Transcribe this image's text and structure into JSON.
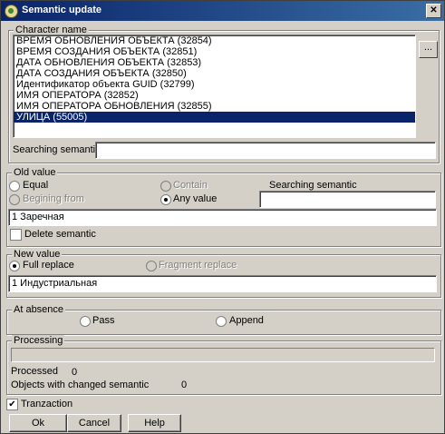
{
  "window": {
    "title": "Semantic update",
    "close_glyph": "✕"
  },
  "character_name": {
    "legend": "Character name",
    "items": [
      "ВРЕМЯ ОБНОВЛЕНИЯ ОБЪЕКТА (32854)",
      "ВРЕМЯ СОЗДАНИЯ ОБЪЕКТА (32851)",
      "ДАТА ОБНОВЛЕНИЯ ОБЪЕКТА (32853)",
      "ДАТА СОЗДАНИЯ ОБЪЕКТА (32850)",
      "Идентификатор объекта GUID (32799)",
      "ИМЯ ОПЕРАТОРА (32852)",
      "ИМЯ ОПЕРАТОРА ОБНОВЛЕНИЯ (32855)",
      "УЛИЦА (55005)"
    ],
    "selected_index": 7,
    "browse_label": "...",
    "searching_label": "Searching semantic",
    "searching_value": ""
  },
  "old_value": {
    "legend": "Old value",
    "equal": "Equal",
    "contain": "Contain",
    "beginning_from": "Begining from",
    "any_value": "Any value",
    "selected": "any_value",
    "searching_label": "Searching semantic",
    "searching_value": "",
    "value": "1 Заречная",
    "delete_label": "Delete semantic",
    "delete_checked": false
  },
  "new_value": {
    "legend": "New value",
    "full_replace": "Full replace",
    "fragment_replace": "Fragment replace",
    "selected": "full_replace",
    "value": "1 Индустриальная"
  },
  "at_absence": {
    "legend": "At absence",
    "pass": "Pass",
    "append": "Append"
  },
  "processing": {
    "legend": "Processing",
    "progress": 0,
    "processed_label": "Processed",
    "processed_value": "0",
    "changed_label": "Objects with changed semantic",
    "changed_value": "0"
  },
  "tranzaction": {
    "label": "Tranzaction",
    "checked": true,
    "check_glyph": "✔"
  },
  "buttons": {
    "ok": "Ok",
    "cancel": "Cancel",
    "help": "Help"
  }
}
